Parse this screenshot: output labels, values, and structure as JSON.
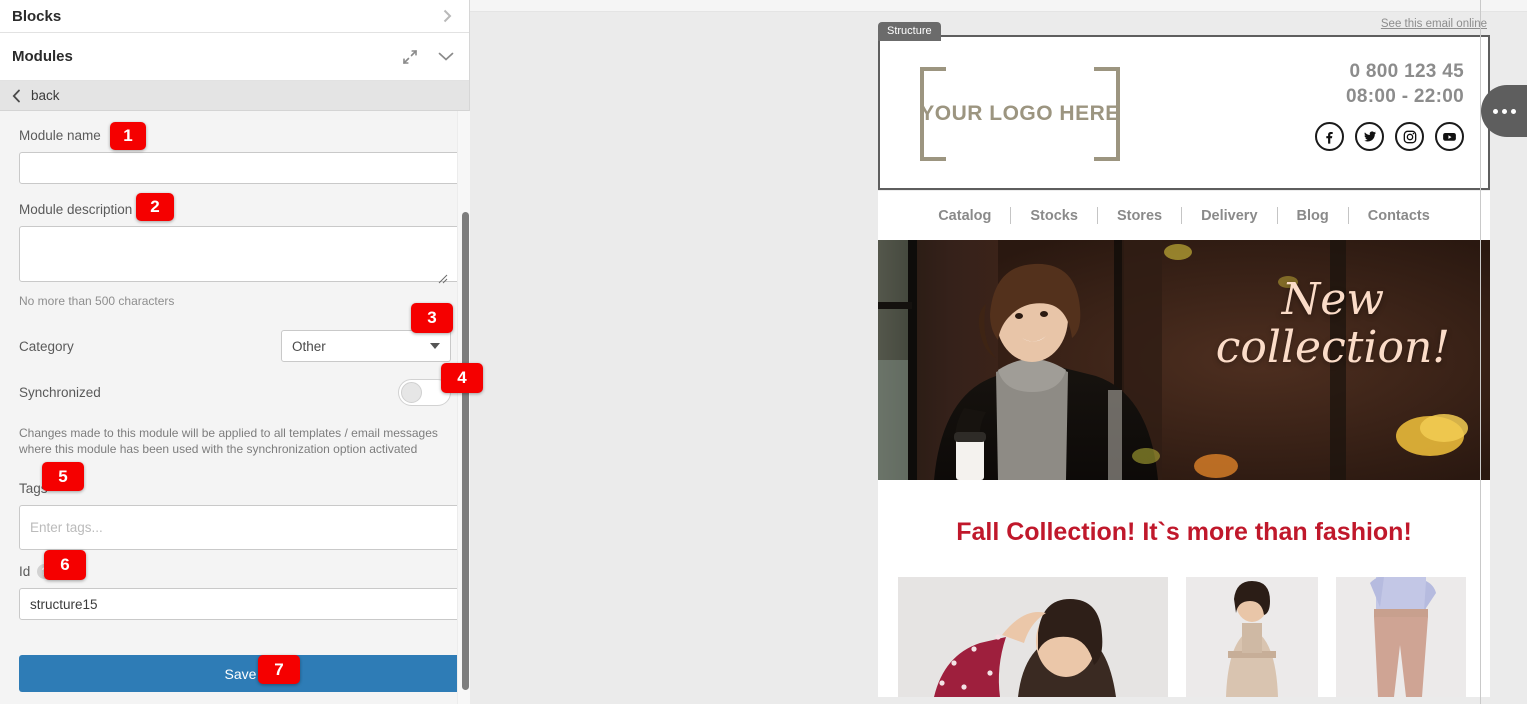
{
  "sidebar": {
    "blocks_title": "Blocks",
    "modules_title": "Modules",
    "back_label": "back",
    "fields": {
      "module_name_label": "Module name",
      "module_name_value": "",
      "module_description_label": "Module description",
      "module_description_value": "",
      "description_hint": "No more than 500 characters",
      "category_label": "Category",
      "category_value": "Other",
      "synchronized_label": "Synchronized",
      "synchronized_state": "off",
      "sync_help": "Changes made to this module will be applied to all templates / email messages where this module has been used with the synchronization option activated",
      "tags_label": "Tags",
      "tags_placeholder": "Enter tags...",
      "tags_value": "",
      "id_label": "Id",
      "id_value": "structure15"
    },
    "save_label": "Save",
    "callouts": [
      "1",
      "2",
      "3",
      "4",
      "5",
      "6",
      "7"
    ]
  },
  "canvas": {
    "structure_tab": "Structure",
    "see_online": "See this email online",
    "email": {
      "logo_text": "YOUR LOGO HERE",
      "phone": "0 800 123 45",
      "hours": "08:00 - 22:00",
      "socials": [
        "facebook-icon",
        "twitter-icon",
        "instagram-icon",
        "youtube-icon"
      ],
      "nav": [
        "Catalog",
        "Stocks",
        "Stores",
        "Delivery",
        "Blog",
        "Contacts"
      ],
      "hero_line1": "New",
      "hero_line2": "collection!",
      "headline": "Fall Collection! It`s more than fashion!"
    }
  },
  "colors": {
    "accent_red": "#f50000",
    "headline_red": "#c0182b",
    "save_blue": "#2e7cb6",
    "logo_olive": "#9c9580"
  }
}
